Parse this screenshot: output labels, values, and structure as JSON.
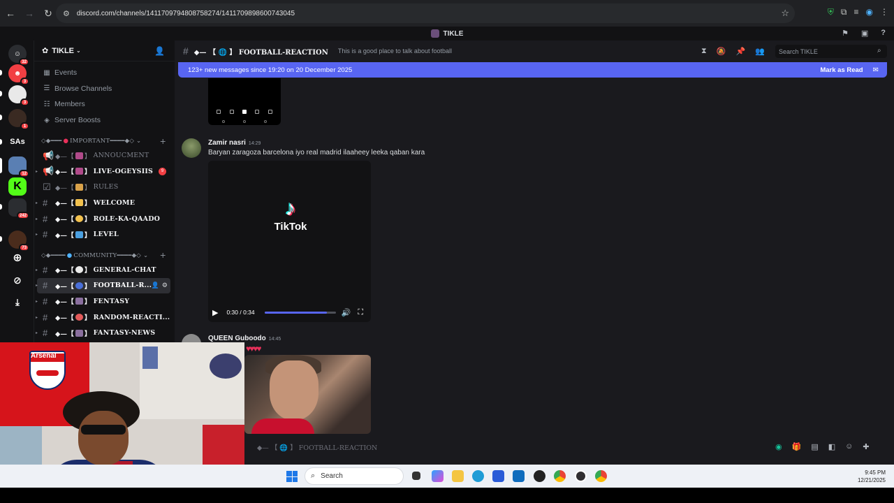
{
  "browser": {
    "url": "discord.com/channels/1411709794808758274/1411709898600743045",
    "nav": [
      "back",
      "forward",
      "reload"
    ]
  },
  "discord_bar": {
    "server_title": "TIKLE"
  },
  "server_rail": {
    "badges": [
      "32",
      "3",
      "3",
      "1",
      "12",
      "242",
      "73"
    ],
    "text_server": "SAs"
  },
  "sidebar": {
    "server_name": "TIKLE",
    "menu": [
      {
        "label": "Events",
        "icon": "calendar-icon"
      },
      {
        "label": "Browse Channels",
        "icon": "list-icon"
      },
      {
        "label": "Members",
        "icon": "members-icon"
      },
      {
        "label": "Server Boosts",
        "icon": "boost-icon"
      }
    ],
    "categories": [
      {
        "name": "IMPORTANT"
      },
      {
        "name": "COMMUNITY"
      }
    ],
    "channels": [
      {
        "name": "ANNOUCMENT",
        "prefix": "◆— 【",
        "suffix": "】"
      },
      {
        "name": "LIVE-OGEYSIIS",
        "badge": "9"
      },
      {
        "name": "RULES"
      },
      {
        "name": "WELCOME"
      },
      {
        "name": "ROLE-KA-QAADO"
      },
      {
        "name": "LEVEL"
      },
      {
        "name": "GENERAL-CHAT"
      },
      {
        "name": "FOOTBALL-R..."
      },
      {
        "name": "FENTASY"
      },
      {
        "name": "RANDOM-REACTI..."
      },
      {
        "name": "FANTASY-NEWS"
      }
    ],
    "channel_prefix": "◆—【",
    "channel_suffix": "】"
  },
  "header": {
    "channel_title": "◆— 【 🌐 】 FOOTBALL-REACTION",
    "topic": "This is a good place to talk about football",
    "search_placeholder": "Search TIKLE"
  },
  "banner": {
    "text": "123+ new messages since 19:20 on 20 December 2025",
    "action": "Mark as Read"
  },
  "messages": [
    {
      "author": "Zamir nasri",
      "time": "14:29",
      "text": "Baryan zaragoza barcelona iyo real madrid ilaaheey leeka qaban kara"
    },
    {
      "author": "QUEEN Guboodo",
      "time": "14:45",
      "text": "♥♥♥♥"
    }
  ],
  "video": {
    "brand": "TikTok",
    "time": "0:30 / 0:34",
    "progress": 0.88
  },
  "composer": {
    "placeholder": "◆— 【 🌐 】 FOOTBALL-REACTION"
  },
  "webcam": {
    "flag_text": "Arsenal"
  },
  "taskbar": {
    "search_label": "Search",
    "time": "9:45 PM",
    "date": "12/21/2025"
  },
  "colors": {
    "accent": "#5865f2",
    "badge": "#f23f43",
    "background": "#1a1a1e",
    "sidebar": "#121214"
  }
}
